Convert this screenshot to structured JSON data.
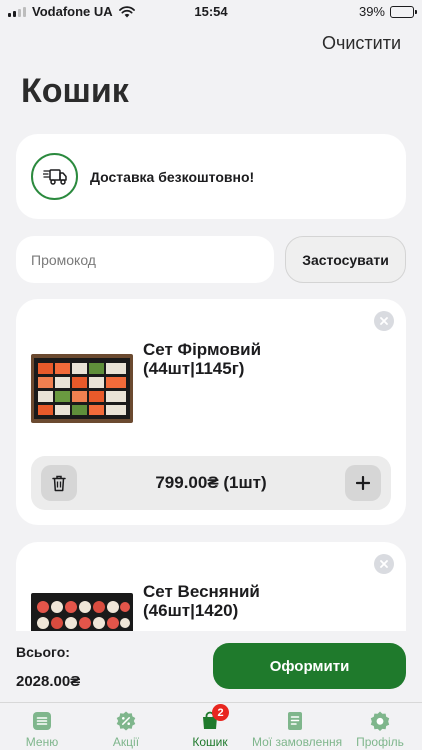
{
  "status_bar": {
    "carrier": "Vodafone UA",
    "time": "15:54",
    "battery": "39%",
    "battery_level": 0.39
  },
  "header": {
    "clear_label": "Очистити",
    "title": "Кошик"
  },
  "delivery": {
    "text": "Доставка безкоштовно!",
    "icon": "delivery-truck-icon"
  },
  "promo": {
    "placeholder": "Промокод",
    "value": "",
    "apply_label": "Застосувати"
  },
  "cart_items": [
    {
      "name": "Сет Фірмовий (44шт|1145г)",
      "price_qty": "799.00₴ (1шт)"
    },
    {
      "name": "Сет Весняний (46шт|1420)",
      "price_qty": ""
    }
  ],
  "footer": {
    "total_label": "Всього:",
    "total_value": "2028.00₴",
    "checkout_label": "Оформити"
  },
  "tabs": [
    {
      "label": "Меню",
      "icon": "menu-icon",
      "active": false
    },
    {
      "label": "Акції",
      "icon": "promotions-icon",
      "active": false
    },
    {
      "label": "Кошик",
      "icon": "cart-icon",
      "active": true,
      "badge": "2"
    },
    {
      "label": "Мої замовлення",
      "icon": "orders-icon",
      "active": false
    },
    {
      "label": "Профіль",
      "icon": "profile-icon",
      "active": false
    }
  ],
  "colors": {
    "accent": "#1f7a2c",
    "accent_light": "#7fb68c",
    "badge": "#e8261f",
    "background": "#f2f2f4"
  }
}
